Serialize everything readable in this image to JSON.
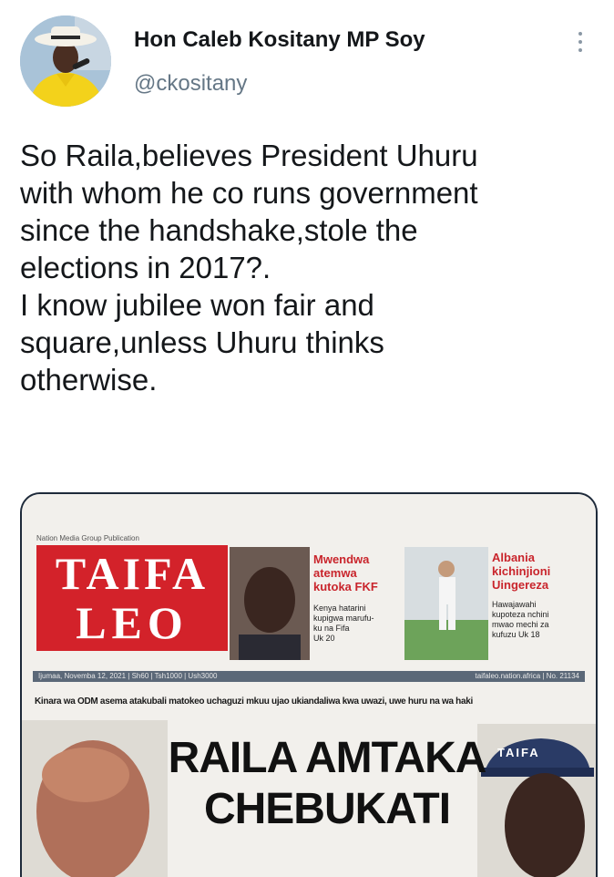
{
  "author": {
    "display_name": "Hon Caleb Kositany MP Soy",
    "handle": "@ckositany"
  },
  "tweet": {
    "text": "So Raila,believes President Uhuru\nwith whom he co runs government\nsince the handshake,stole the\nelections in 2017?.\nI know jubilee won fair and\nsquare,unless Uhuru thinks\notherwise."
  },
  "icons": {
    "more": "more-vertical-icon"
  },
  "newspaper": {
    "publisher_line": "Nation Media Group Publication",
    "masthead_line1": "TAIFA",
    "masthead_line2": "LEO",
    "teaser1_head": "Mwendwa\natemwa\nkutoka FKF",
    "teaser1_sub": "Kenya hatarini\nkupigwa marufu-\nku na Fifa\nUk 20",
    "teaser2_head": "Albania\nkichinjioni\nUingereza",
    "teaser2_sub": "Hawajawahi\nkupoteza nchini\nmwao mechi za\nkufuzu  Uk 18",
    "dateline": "Ijumaa, Novemba 12, 2021 | Sh60 | Tsh1000 | Ush3000",
    "dateline_right": "taifaleo.nation.africa | No. 21134",
    "strapline": "Kinara wa ODM asema atakubali matokeo uchaguzi mkuu ujao ukiandaliwa kwa uwazi, uwe huru na wa haki",
    "headline_line1": "RAILA AMTAKA",
    "headline_line2": "CHEBUKATI",
    "hat_label": "TAIFA"
  },
  "colors": {
    "masthead_red": "#d3222a",
    "handle_gray": "#657786",
    "avatar_yellow": "#f3d21b"
  }
}
